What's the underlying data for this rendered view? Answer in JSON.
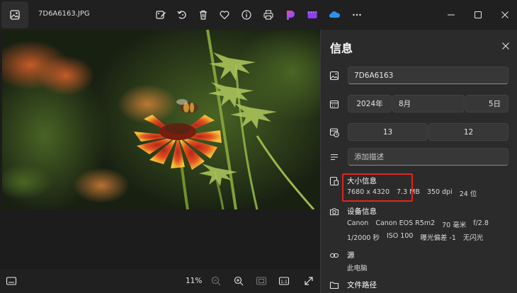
{
  "window": {
    "file_name": "7D6A6163.JPG",
    "toolbar_icons": [
      "edit-image-icon",
      "rotate-icon",
      "delete-icon",
      "favorite-icon",
      "info-icon",
      "print-icon",
      "designer-icon",
      "clipchamp-icon",
      "onedrive-icon",
      "more-icon"
    ],
    "controls": [
      "minimize-icon",
      "maximize-icon",
      "close-icon"
    ]
  },
  "bottombar": {
    "zoom": "11%"
  },
  "info_panel": {
    "title": "信息",
    "name_value": "7D6A6163",
    "date": {
      "year": "2024年",
      "month": "8月",
      "day": "5日"
    },
    "time": {
      "hour": "13",
      "minute": "12"
    },
    "description_placeholder": "添加描述",
    "size": {
      "title": "大小信息",
      "dimensions": "7680 x 4320",
      "file_size": "7.3 MB",
      "dpi": "350 dpi",
      "bit_depth": "24 位"
    },
    "device": {
      "title": "设备信息",
      "make": "Canon",
      "model": "Canon EOS R5m2",
      "focal": "70 毫米",
      "aperture": "f/2.8",
      "exposure": "1/2000 秒",
      "iso": "ISO 100",
      "exposure_bias": "曝光偏差 -1",
      "flash": "无闪光"
    },
    "source": {
      "title": "源",
      "value": "此电脑"
    },
    "path": {
      "title": "文件路径"
    }
  },
  "colors": {
    "background": "#202020",
    "panel": "#2b2b2b",
    "field": "#373737",
    "highlight": "#e0251b"
  }
}
